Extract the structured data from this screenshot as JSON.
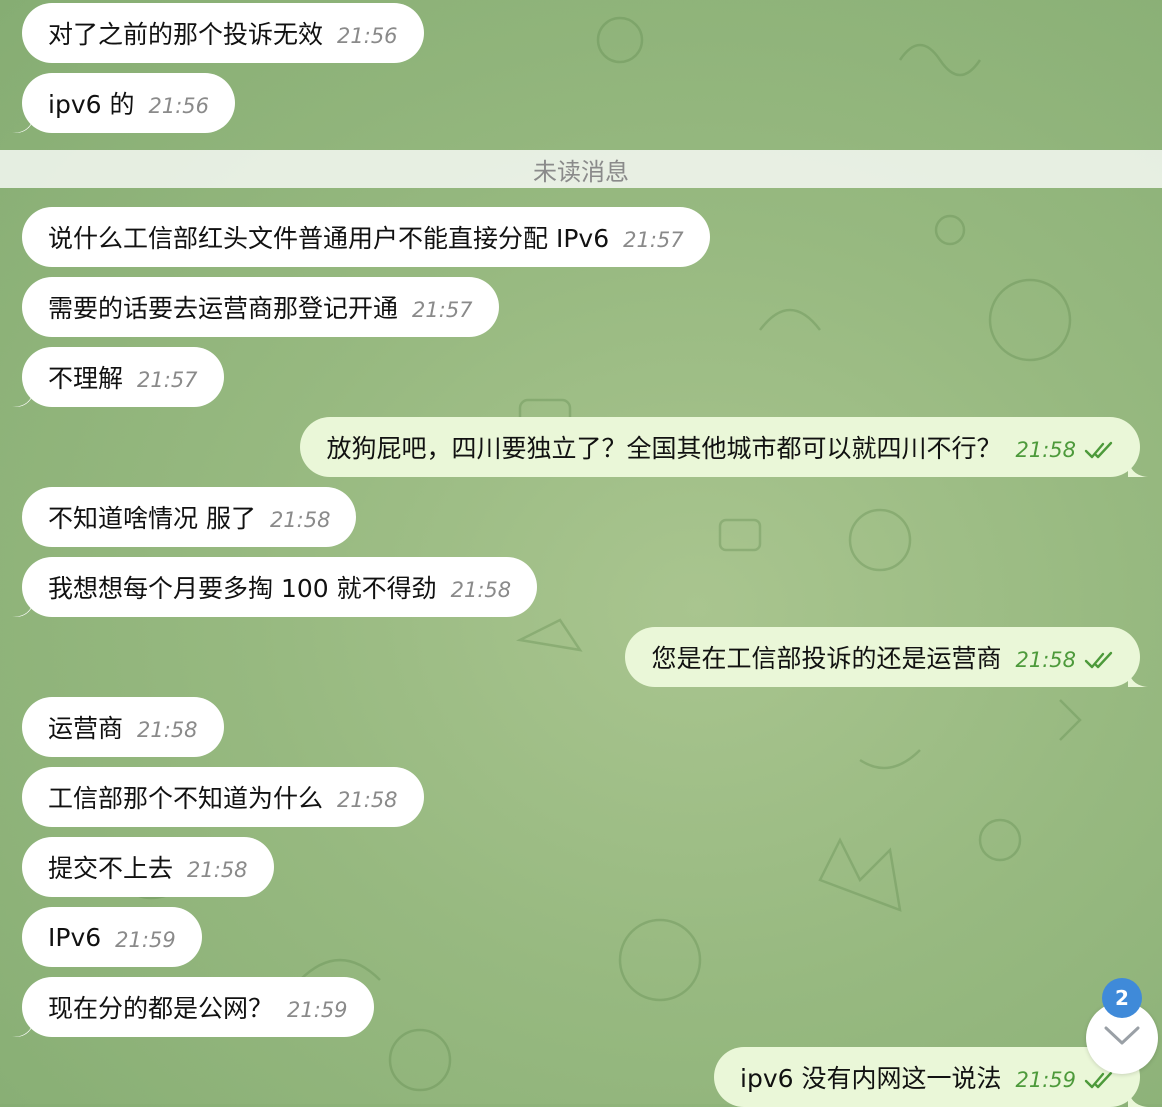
{
  "colors": {
    "incoming_bubble": "#ffffff",
    "outgoing_bubble": "#eaf7d8",
    "outgoing_time": "#4d9a3b",
    "badge": "#3f8ad9"
  },
  "unread_divider": "未读消息",
  "messages": [
    {
      "dir": "in",
      "text": "对了之前的那个投诉无效",
      "time": "21:56"
    },
    {
      "dir": "in",
      "text": "ipv6 的",
      "time": "21:56"
    },
    {
      "dir": "in",
      "text": "说什么工信部红头文件普通用户不能直接分配 IPv6",
      "time": "21:57"
    },
    {
      "dir": "in",
      "text": "需要的话要去运营商那登记开通",
      "time": "21:57"
    },
    {
      "dir": "in",
      "text": "不理解",
      "time": "21:57"
    },
    {
      "dir": "out",
      "text": "放狗屁吧，四川要独立了？全国其他城市都可以就四川不行？",
      "time": "21:58"
    },
    {
      "dir": "in",
      "text": "不知道啥情况 服了",
      "time": "21:58"
    },
    {
      "dir": "in",
      "text": "我想想每个月要多掏 100 就不得劲",
      "time": "21:58"
    },
    {
      "dir": "out",
      "text": "您是在工信部投诉的还是运营商",
      "time": "21:58"
    },
    {
      "dir": "in",
      "text": "运营商",
      "time": "21:58"
    },
    {
      "dir": "in",
      "text": "工信部那个不知道为什么",
      "time": "21:58"
    },
    {
      "dir": "in",
      "text": "提交不上去",
      "time": "21:58"
    },
    {
      "dir": "in",
      "text": "IPv6",
      "time": "21:59"
    },
    {
      "dir": "in",
      "text": "现在分的都是公网？",
      "time": "21:59"
    },
    {
      "dir": "out",
      "text": "ipv6 没有内网这一说法",
      "time": "21:59"
    }
  ],
  "scroll_button": {
    "icon": "chevron-down-icon",
    "badge": "2"
  }
}
